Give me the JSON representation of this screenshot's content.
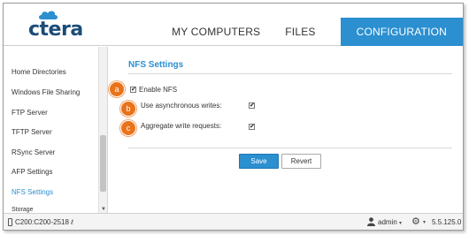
{
  "brand": {
    "logo_text": "ctera"
  },
  "nav": {
    "items": [
      {
        "label": "MY COMPUTERS"
      },
      {
        "label": "FILES"
      },
      {
        "label": "CONFIGURATION"
      }
    ]
  },
  "sidebar": {
    "items": [
      {
        "label": "Home Directories"
      },
      {
        "label": "Windows File Sharing"
      },
      {
        "label": "FTP Server"
      },
      {
        "label": "TFTP Server"
      },
      {
        "label": "RSync Server"
      },
      {
        "label": "AFP Settings"
      },
      {
        "label": "NFS Settings"
      },
      {
        "label": "Storage"
      }
    ]
  },
  "main": {
    "title": "NFS Settings",
    "options": [
      {
        "badge": "a",
        "label": "Enable NFS",
        "checked": true,
        "check_glyph": "✔"
      },
      {
        "badge": "b",
        "label": "Use asynchronous writes:",
        "checked": true,
        "check_glyph": "✔"
      },
      {
        "badge": "c",
        "label": "Aggregate write requests:",
        "checked": true,
        "check_glyph": "✔"
      }
    ],
    "save_label": "Save",
    "revert_label": "Revert"
  },
  "status": {
    "device": "C200:C200-2518",
    "device_suffix": "ℓ",
    "user": "admin",
    "user_caret": "▾",
    "gear_caret": "▾",
    "version": "5.5.125.0"
  },
  "colors": {
    "accent": "#2b8fd0",
    "badge": "#e8731a",
    "logo": "#1c4c78"
  }
}
